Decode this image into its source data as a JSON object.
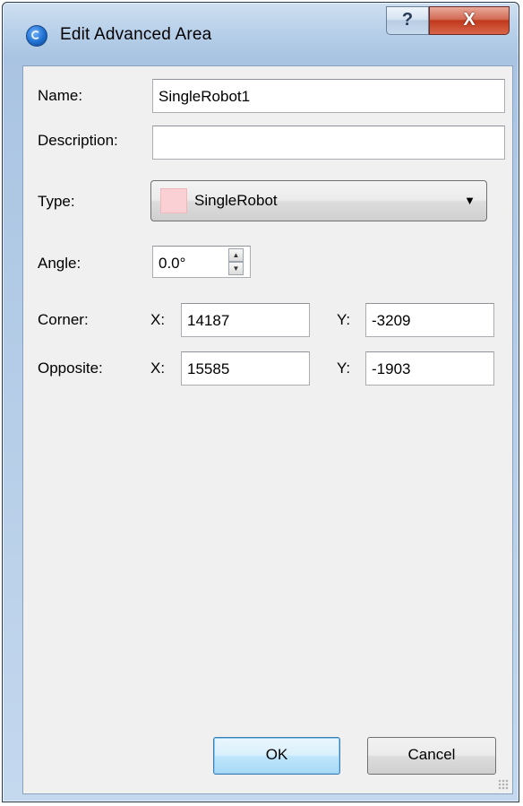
{
  "window": {
    "title": "Edit Advanced Area",
    "help_glyph": "?",
    "close_glyph": "X"
  },
  "form": {
    "name_label": "Name:",
    "name_value": "SingleRobot1",
    "description_label": "Description:",
    "description_value": "",
    "type_label": "Type:",
    "type_value": "SingleRobot",
    "type_swatch_color": "#fbd0d4",
    "angle_label": "Angle:",
    "angle_value": "0.0°",
    "corner_label": "Corner:",
    "opposite_label": "Opposite:",
    "x_label": "X:",
    "y_label": "Y:",
    "corner_x": "14187",
    "corner_y": "-3209",
    "opposite_x": "15585",
    "opposite_y": "-1903"
  },
  "buttons": {
    "ok": "OK",
    "cancel": "Cancel"
  },
  "icons": {
    "app": "app-logo-icon",
    "help": "help-icon",
    "close": "close-icon",
    "dropdown": "dropdown-arrow-icon",
    "spin_up": "spin-up-icon",
    "spin_down": "spin-down-icon",
    "resize": "resize-grip-icon"
  }
}
